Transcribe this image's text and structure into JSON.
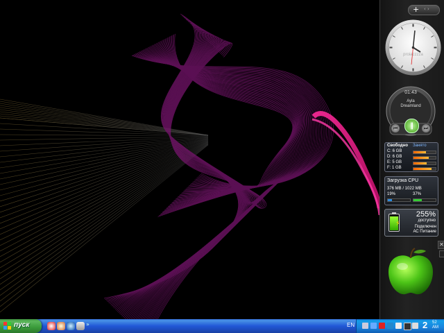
{
  "sidebar": {
    "add_label": "+",
    "nav_label": "‹ ›"
  },
  "clock": {
    "label": "proiazzzza"
  },
  "player": {
    "time": "01:43",
    "artist": "Ayla",
    "track": "Dreamland"
  },
  "drives": {
    "free_header": "Свободно",
    "used_header": "Занято",
    "rows": [
      {
        "label": "C: 6 GB",
        "used_fraction": 0.55
      },
      {
        "label": "D: 6 GB",
        "used_fraction": 0.7
      },
      {
        "label": "E: 5 GB",
        "used_fraction": 0.6
      },
      {
        "label": "F: 1 GB",
        "used_fraction": 0.8
      }
    ]
  },
  "cpu": {
    "title": "Загрузка CPU",
    "memory": "376 MB / 1022 MB",
    "core1": "19%",
    "core2": "37%",
    "core1_fraction": 0.19,
    "core2_fraction": 0.37
  },
  "battery": {
    "percent": "255%",
    "available": "доступно",
    "status1": "Подключен",
    "status2": "АС Питание",
    "level_fraction": 0.85
  },
  "taskbar": {
    "start_label": "пуск",
    "quicklaunch_more": "»",
    "language": "EN",
    "time_hour": "2",
    "time_min": "52",
    "time_suffix": "AM"
  },
  "colors": {
    "taskbar_blue": "#2157d7",
    "start_green": "#3a9a3a",
    "wave_magenta": "#8a1a7a",
    "wave_pink": "#ff1aa8"
  }
}
